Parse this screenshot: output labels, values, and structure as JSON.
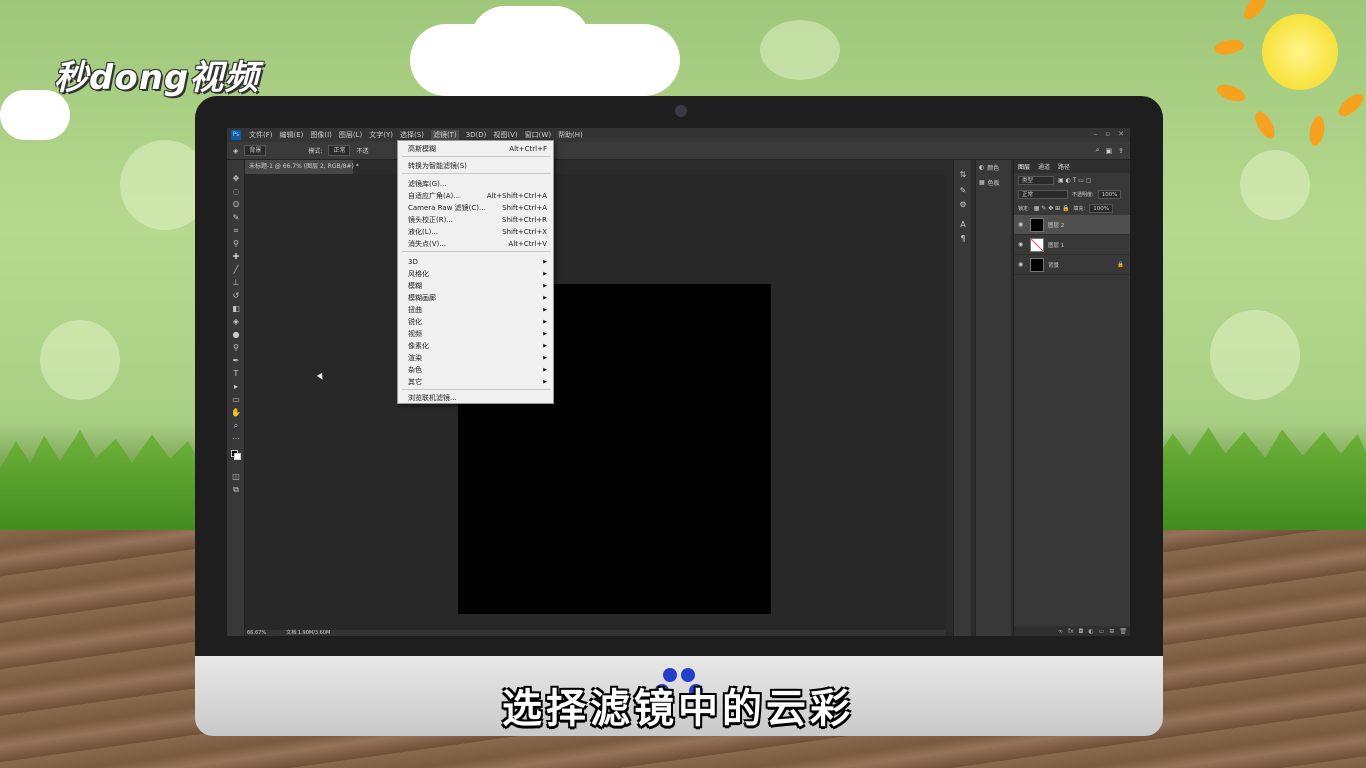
{
  "watermark": {
    "logo_text": "秒dong视频"
  },
  "subtitle": "选择滤镜中的云彩",
  "photoshop": {
    "menubar": [
      "文件(F)",
      "编辑(E)",
      "图像(I)",
      "图层(L)",
      "文字(Y)",
      "选择(S)",
      "滤镜(T)",
      "3D(D)",
      "视图(V)",
      "窗口(W)",
      "帮助(H)"
    ],
    "options_bar": {
      "tool_preset": "背景",
      "mode_label": "模式:",
      "mode_value": "正常",
      "opacity_label": "不透",
      "tail_label": "图层"
    },
    "document_tab": "未标题-1 @ 66.7% (图层 2, RGB/8#) *",
    "status_bar": {
      "zoom": "66.67%",
      "doc_info": "文档:1.90M/3.60M"
    },
    "filter_menu": {
      "items": [
        {
          "label": "高斯模糊",
          "shortcut": "Alt+Ctrl+F",
          "submenu": false
        },
        {
          "label": "转换为智能滤镜(S)",
          "shortcut": "",
          "submenu": false
        },
        {
          "label": "滤镜库(G)...",
          "shortcut": "",
          "submenu": false
        },
        {
          "label": "自适应广角(A)...",
          "shortcut": "Alt+Shift+Ctrl+A",
          "submenu": false
        },
        {
          "label": "Camera Raw 滤镜(C)...",
          "shortcut": "Shift+Ctrl+A",
          "submenu": false
        },
        {
          "label": "镜头校正(R)...",
          "shortcut": "Shift+Ctrl+R",
          "submenu": false
        },
        {
          "label": "液化(L)...",
          "shortcut": "Shift+Ctrl+X",
          "submenu": false
        },
        {
          "label": "消失点(V)...",
          "shortcut": "Alt+Ctrl+V",
          "submenu": false
        },
        {
          "label": "3D",
          "shortcut": "",
          "submenu": true
        },
        {
          "label": "风格化",
          "shortcut": "",
          "submenu": true
        },
        {
          "label": "模糊",
          "shortcut": "",
          "submenu": true
        },
        {
          "label": "模糊画廊",
          "shortcut": "",
          "submenu": true
        },
        {
          "label": "扭曲",
          "shortcut": "",
          "submenu": true
        },
        {
          "label": "锐化",
          "shortcut": "",
          "submenu": true
        },
        {
          "label": "视频",
          "shortcut": "",
          "submenu": true
        },
        {
          "label": "像素化",
          "shortcut": "",
          "submenu": true
        },
        {
          "label": "渲染",
          "shortcut": "",
          "submenu": true
        },
        {
          "label": "杂色",
          "shortcut": "",
          "submenu": true
        },
        {
          "label": "其它",
          "shortcut": "",
          "submenu": true
        },
        {
          "label": "浏览联机滤镜...",
          "shortcut": "",
          "submenu": false
        }
      ]
    },
    "color_panel": {
      "color_tab": "颜色",
      "swatches_tab": "色板"
    },
    "layers_panel": {
      "tabs": [
        "图层",
        "通道",
        "路径"
      ],
      "kind_filter": "类型",
      "blend_mode": "正常",
      "opacity_label": "不透明度:",
      "opacity_value": "100%",
      "lock_label": "锁定:",
      "fill_label": "填充:",
      "fill_value": "100%",
      "layers": [
        {
          "name": "图层 2",
          "selected": true,
          "thumb": "#000000"
        },
        {
          "name": "图层 1",
          "selected": false,
          "thumb": "#ffffff"
        },
        {
          "name": "背景",
          "selected": false,
          "thumb": "#000000"
        }
      ]
    }
  }
}
